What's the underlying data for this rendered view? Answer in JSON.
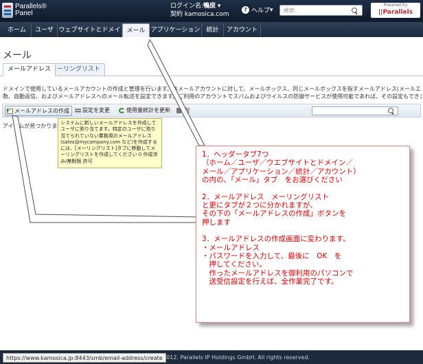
{
  "header": {
    "logo_line1": "Parallels®",
    "logo_line2": "Panel",
    "login_label": "ログイン名:",
    "login_name": "鴨庶",
    "contract_label": "契約",
    "contract_value": "kamosica.com",
    "help_label": "ヘルプ",
    "search_placeholder": "検索...",
    "powered_by": "Powered by",
    "powered_brand": "||Parallels"
  },
  "nav": {
    "tabs": [
      {
        "label": "ホーム"
      },
      {
        "label": "ユーザ"
      },
      {
        "label": "ウェブサイトとドメイン"
      },
      {
        "label": "メール",
        "active": true
      },
      {
        "label": "アプリケーション"
      },
      {
        "label": "統計"
      },
      {
        "label": "アカウント"
      }
    ]
  },
  "main": {
    "title": "メール",
    "subtabs": [
      {
        "label": "メールアドレス",
        "active": true
      },
      {
        "label": "メーリングリスト"
      }
    ],
    "description_line1": "ドメインで使用しているメールアカウントの作成と管理を行います。各メールアカウントに対して、メールボックス、同じメールボックスを指すメールアドレス(メールエイリアス)の",
    "description_line2": "数、自動返信、およびメールアドレスへのメール転送を設定できます。ご利用のアカウントでスパムおよびウイルスの防御サービスが使用可能であれば、その設定もできます。",
    "toolbar": {
      "create_label": "メールアドレスの作成",
      "settings_label": "設定を変更",
      "refresh_label": "使用量統計を更新",
      "delete_label": "削"
    },
    "empty_message": "アイテムが見つかりませ",
    "tooltip": "システムに新しいメールアドレスを作成して ユーザに割り当てます。特定のユーザに割り当てられていない業務用のメールアドレス(sales@mycompany.com など)を作成するには、[メーリングリスト]タブに移動してメーリングリストを作成してください 0 作成済み/無制限 許可"
  },
  "callout": {
    "lines1": [
      "1．ヘッダータブ7つ",
      "（ホーム／ユーザ／ウエブサイトとドメイン／",
      "メール／アプリケーション／統計／アカウント）",
      "の内の、「メール」タブ　をお選びください"
    ],
    "lines2": [
      "2．メールアドレス　メーリングリスト",
      "と更にタブが２つに分かれますが、",
      "その下の「メールアドレスの作成」ボタンを",
      "押します"
    ],
    "lines3": [
      "3．メールアドレスの作成画面に変わります。",
      "・メールアドレス",
      "・パスワードを入力して、最後に　OK　を",
      "　押してください。",
      "　作ったメールアドレスを御利用のパソコンで",
      "　送受信設定を行えば、全作業完了です。"
    ]
  },
  "status_url": "https://www.kamosica.jp:8443/smb/email-address/create",
  "copyright": "99-2012. Parallels IP Holdings GmbH. All rights reserved."
}
